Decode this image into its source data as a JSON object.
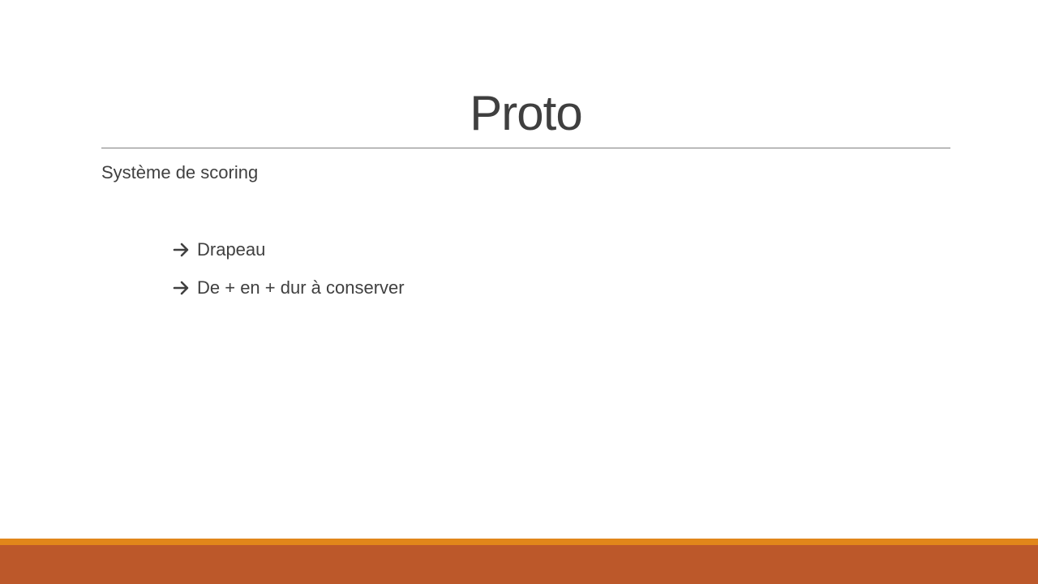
{
  "slide": {
    "title": "Proto",
    "body": "Système de scoring",
    "bullets": [
      {
        "icon": "right-arrow-icon",
        "text": "Drapeau"
      },
      {
        "icon": "right-arrow-icon",
        "text": "De + en + dur à conserver"
      }
    ]
  },
  "colors": {
    "text": "#404040",
    "divider": "#7f7f7f",
    "footer_accent": "#e1861a",
    "footer": "#bc582a"
  }
}
